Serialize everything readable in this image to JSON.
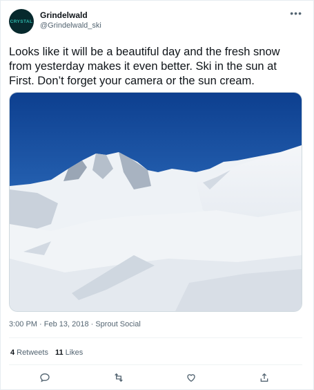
{
  "account": {
    "avatar_text": "CRYSTAL",
    "name": "Grindelwald",
    "handle": "@Grindelwald_ski"
  },
  "tweet": {
    "text": "Looks like it will be a beautiful day and the fresh snow from yesterday makes it even better. Ski in the sun at First. Don’t forget your camera or the sun cream.",
    "timestamp": "3:00 PM · Feb 13, 2018 · Sprout Social"
  },
  "stats": {
    "retweets_count": "4",
    "retweets_label": "Retweets",
    "likes_count": "11",
    "likes_label": "Likes"
  },
  "icons": {
    "more": "more-dots-icon",
    "reply": "reply-icon",
    "retweet": "retweet-icon",
    "like": "heart-icon",
    "share": "share-icon"
  },
  "colors": {
    "text": "#0f1419",
    "secondary": "#536471",
    "sky": "#1c57a6",
    "snow": "#f3f6f8"
  }
}
